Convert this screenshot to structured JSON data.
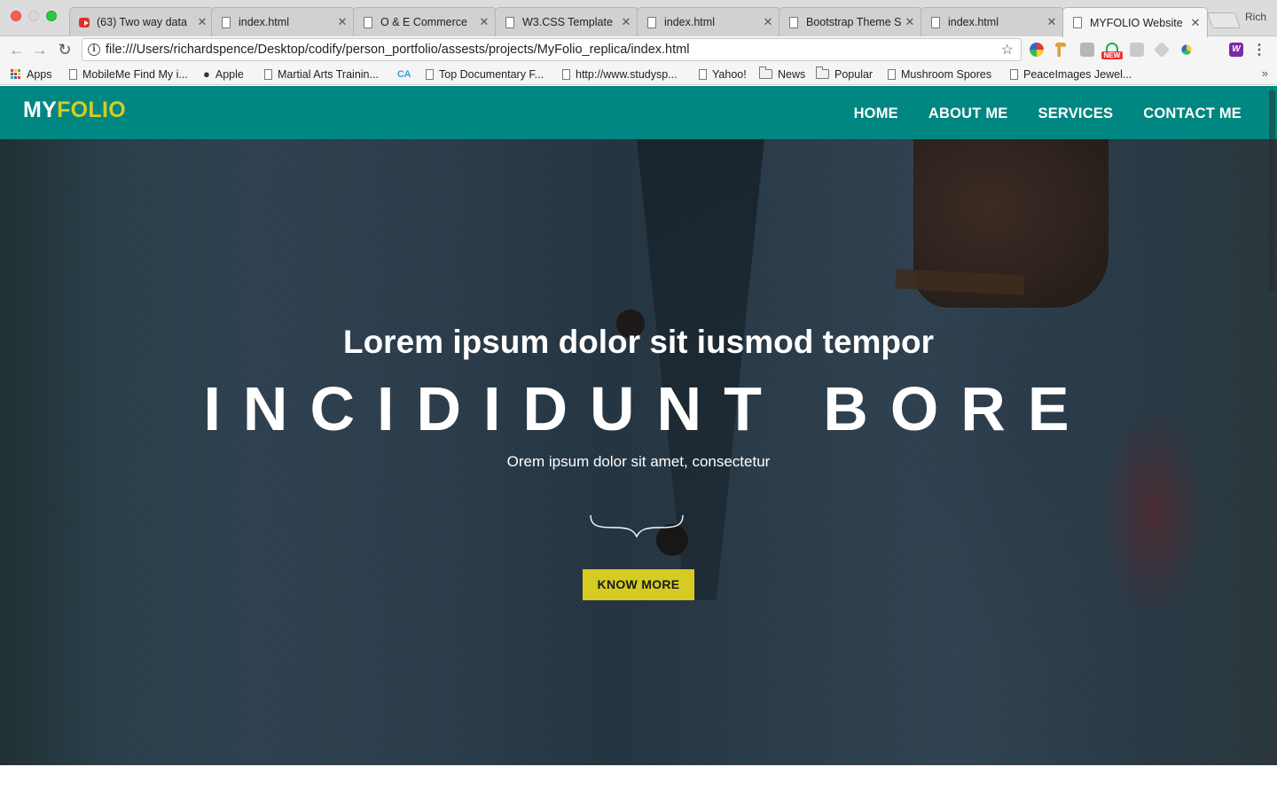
{
  "browser": {
    "tabs": [
      {
        "title": "(63) Two way data",
        "icon": "youtube-icon"
      },
      {
        "title": "index.html",
        "icon": "page-icon"
      },
      {
        "title": "O & E Commerce",
        "icon": "page-icon"
      },
      {
        "title": "W3.CSS Template",
        "icon": "page-icon"
      },
      {
        "title": "index.html",
        "icon": "page-icon"
      },
      {
        "title": "Bootstrap Theme S",
        "icon": "page-icon"
      },
      {
        "title": "index.html",
        "icon": "page-icon"
      },
      {
        "title": "MYFOLIO Website",
        "icon": "page-icon",
        "active": true
      }
    ],
    "tab_close_glyph": "✕",
    "profile_name": "Rich",
    "url": "file:///Users/richardspence/Desktop/codify/person_portfolio/assests/projects/MyFolio_replica/index.html",
    "new_badge": "NEW",
    "bookmarks": [
      {
        "label": "Apps",
        "icon": "apps-grid-icon"
      },
      {
        "label": "MobileMe Find My i...",
        "icon": "page-icon"
      },
      {
        "label": "Apple",
        "icon": "apple-icon"
      },
      {
        "label": "Martial Arts Trainin...",
        "icon": "page-icon"
      },
      {
        "label": "",
        "icon": "ca-icon"
      },
      {
        "label": "Top Documentary F...",
        "icon": "page-icon"
      },
      {
        "label": "http://www.studysp...",
        "icon": "page-icon"
      },
      {
        "label": "Yahoo!",
        "icon": "page-icon"
      },
      {
        "label": "News",
        "icon": "folder-icon"
      },
      {
        "label": "Popular",
        "icon": "folder-icon"
      },
      {
        "label": "Mushroom Spores",
        "icon": "page-icon"
      },
      {
        "label": "PeaceImages Jewel...",
        "icon": "page-icon"
      }
    ],
    "ca_glyph": "CA",
    "more_glyph": "»"
  },
  "site": {
    "logo": {
      "part1": "MY",
      "part2": "FOLIO"
    },
    "nav": [
      "HOME",
      "ABOUT ME",
      "SERVICES",
      "CONTACT ME"
    ],
    "hero": {
      "heading": "Lorem ipsum dolor sit iusmod tempor",
      "big_text": "INCIDIDUNT BORE",
      "subheading": "Orem ipsum dolor sit amet, consectetur",
      "cta": "KNOW MORE"
    }
  },
  "colors": {
    "navbar": "#018782",
    "accent": "#d5cb23",
    "text_on_dark": "#ffffff"
  }
}
